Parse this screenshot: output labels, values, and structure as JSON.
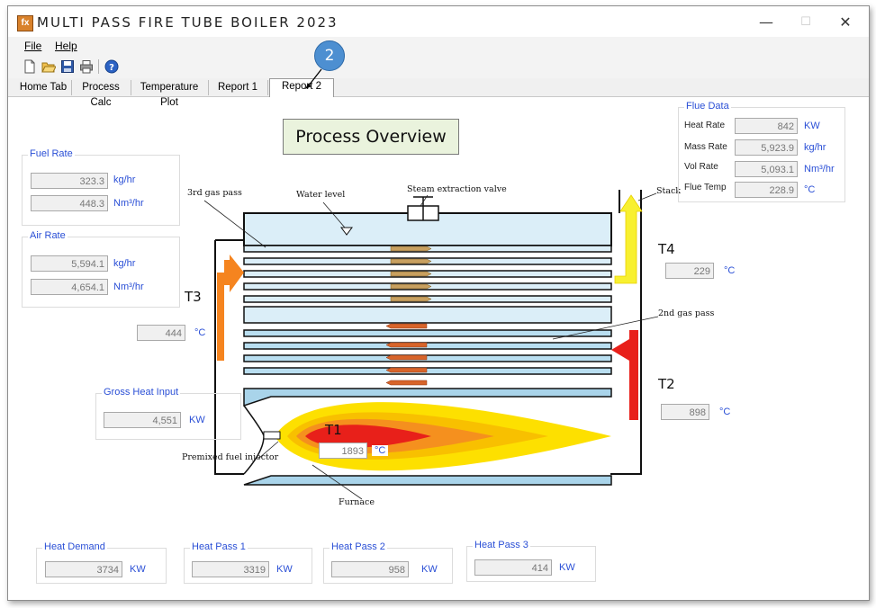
{
  "window": {
    "title": "MULTI PASS FIRE TUBE BOILER 2023",
    "icon_text": "fx",
    "controls": {
      "minimize": "—",
      "maximize": "☐",
      "close": "✕"
    }
  },
  "menu": {
    "file": "File",
    "help": "Help"
  },
  "tabs": [
    {
      "label": "Home Tab"
    },
    {
      "label": "Process Calc"
    },
    {
      "label": "Temperature Plot"
    },
    {
      "label": "Report 1"
    },
    {
      "label": "Report 2"
    }
  ],
  "callout_badge": "2",
  "overview_title": "Process Overview",
  "fuel_rate": {
    "label": "Fuel Rate",
    "mass_value": "323.3",
    "mass_unit": "kg/hr",
    "vol_value": "448.3",
    "vol_unit": "Nm³/hr"
  },
  "air_rate": {
    "label": "Air Rate",
    "mass_value": "5,594.1",
    "mass_unit": "kg/hr",
    "vol_value": "4,654.1",
    "vol_unit": "Nm³/hr"
  },
  "flue_data": {
    "label": "Flue Data",
    "heat_rate_label": "Heat Rate",
    "heat_rate_value": "842",
    "heat_rate_unit": "KW",
    "mass_rate_label": "Mass Rate",
    "mass_rate_value": "5,923.9",
    "mass_rate_unit": "kg/hr",
    "vol_rate_label": "Vol Rate",
    "vol_rate_value": "5,093.1",
    "vol_rate_unit": "Nm³/hr",
    "flue_temp_label": "Flue Temp",
    "flue_temp_value": "228.9",
    "flue_temp_unit": "°C"
  },
  "gross_heat": {
    "label": "Gross Heat Input",
    "value": "4,551",
    "unit": "KW"
  },
  "temps": {
    "t1": {
      "label": "T1",
      "value": "1893",
      "unit": "°C"
    },
    "t2": {
      "label": "T2",
      "value": "898",
      "unit": "°C"
    },
    "t3": {
      "label": "T3",
      "value": "444",
      "unit": "°C"
    },
    "t4": {
      "label": "T4",
      "value": "229",
      "unit": "°C"
    }
  },
  "diagram_labels": {
    "third_pass": "3rd gas pass",
    "water_level": "Water level",
    "steam_valve": "Steam extraction valve",
    "stack": "Stack",
    "second_pass": "2nd gas pass",
    "fuel_injector": "Premixed fuel injector",
    "furnace": "Furnace"
  },
  "heat_demand": {
    "label": "Heat Demand",
    "value": "3734",
    "unit": "KW"
  },
  "heat_pass_1": {
    "label": "Heat Pass 1",
    "value": "3319",
    "unit": "KW"
  },
  "heat_pass_2": {
    "label": "Heat Pass 2",
    "value": "958",
    "unit": "KW"
  },
  "heat_pass_3": {
    "label": "Heat Pass 3",
    "value": "414",
    "unit": "KW"
  },
  "colors": {
    "label_blue": "#2a4fd6",
    "flame_red": "#e8201a",
    "flame_orange": "#f5901e",
    "flame_yellow": "#fde000",
    "arrow_red": "#e8201a",
    "arrow_orange": "#f5841f",
    "arrow_yellow": "#f8f030",
    "tube_blue": "#a9d4ea"
  }
}
